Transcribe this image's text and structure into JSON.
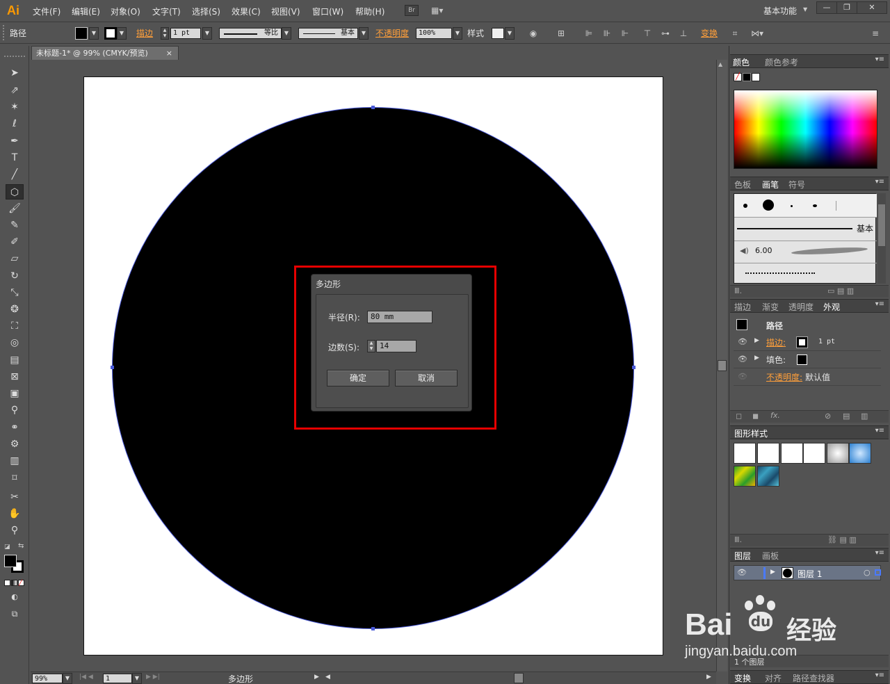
{
  "app": {
    "logo": "Ai",
    "workspace": "基本功能"
  },
  "menu": [
    "文件(F)",
    "编辑(E)",
    "对象(O)",
    "文字(T)",
    "选择(S)",
    "效果(C)",
    "视图(V)",
    "窗口(W)",
    "帮助(H)"
  ],
  "bridge_button": "Br",
  "control": {
    "object_type": "路径",
    "stroke_label": "描边",
    "stroke_weight": "1 pt",
    "profile": "等比",
    "brush": "基本",
    "opacity_label": "不透明度",
    "opacity_value": "100%",
    "style_label": "样式",
    "transform_label": "变换"
  },
  "document": {
    "tab_title": "未标题-1* @ 99% (CMYK/预览)",
    "close": "×"
  },
  "dialog": {
    "title": "多边形",
    "radius_label": "半径(R):",
    "radius_value": "80 mm",
    "sides_label": "边数(S):",
    "sides_value": "14",
    "ok": "确定",
    "cancel": "取消"
  },
  "status": {
    "zoom": "99%",
    "artboard": "1",
    "tool_name": "多边形"
  },
  "panels": {
    "color": {
      "tabs": [
        "颜色",
        "颜色参考"
      ]
    },
    "brushes": {
      "tabs": [
        "色板",
        "画笔",
        "符号"
      ],
      "basic_label": "基本",
      "brush_size": "6.00"
    },
    "appearance": {
      "tabs": [
        "描边",
        "渐变",
        "透明度",
        "外观"
      ],
      "object": "路径",
      "stroke_label": "描边:",
      "stroke_value": "1 pt",
      "fill_label": "填色:",
      "opacity_label": "不透明度:",
      "opacity_value": "默认值"
    },
    "graphic_styles": {
      "title": "图形样式"
    },
    "layers": {
      "tabs": [
        "图层",
        "画板"
      ],
      "layer_name": "图层 1",
      "footer": "1 个图层"
    },
    "bottom": {
      "tabs": [
        "变换",
        "对齐",
        "路径查找器"
      ]
    }
  },
  "watermark": {
    "brand": "Bai",
    "brand2": "du",
    "cn": "经验",
    "url": "jingyan.baidu.com"
  },
  "colors": {
    "accent_orange": "#ff9f3a",
    "highlight_red": "#e60000",
    "path_blue": "#4a5ad8"
  }
}
